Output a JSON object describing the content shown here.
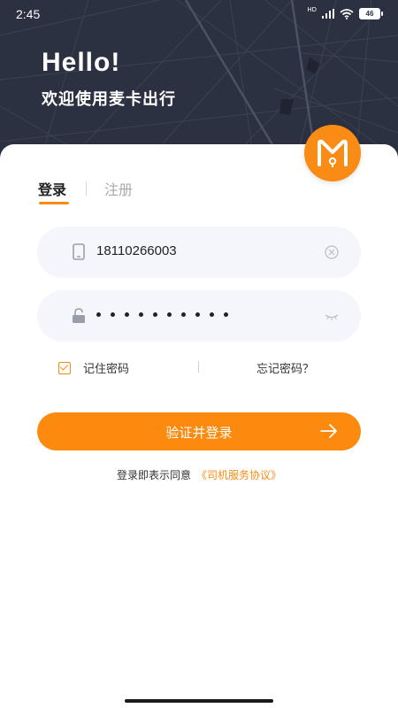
{
  "status_bar": {
    "time": "2:45",
    "network": "HD",
    "battery": "46"
  },
  "header": {
    "greeting": "Hello!",
    "subtitle": "欢迎使用麦卡出行"
  },
  "logo": {
    "icon": "brand-m-icon"
  },
  "tabs": [
    {
      "label": "登录",
      "active": true
    },
    {
      "label": "注册",
      "active": false
    }
  ],
  "form": {
    "phone": {
      "value": "18110266003",
      "icon": "phone-icon",
      "clear_icon": "clear-icon"
    },
    "password": {
      "masked_length": 10,
      "icon": "lock-icon",
      "toggle_icon": "eye-closed-icon"
    },
    "remember_label": "记住密码",
    "remember_checked": true,
    "forgot_label": "忘记密码？"
  },
  "login_button": {
    "label": "验证并登录",
    "icon": "arrow-right-icon"
  },
  "agreement": {
    "text": "登录即表示同意",
    "link": "《司机服务协议》"
  },
  "colors": {
    "accent": "#FB8A0F",
    "hero_bg": "#2B3140",
    "field_bg": "#F5F6FB"
  }
}
